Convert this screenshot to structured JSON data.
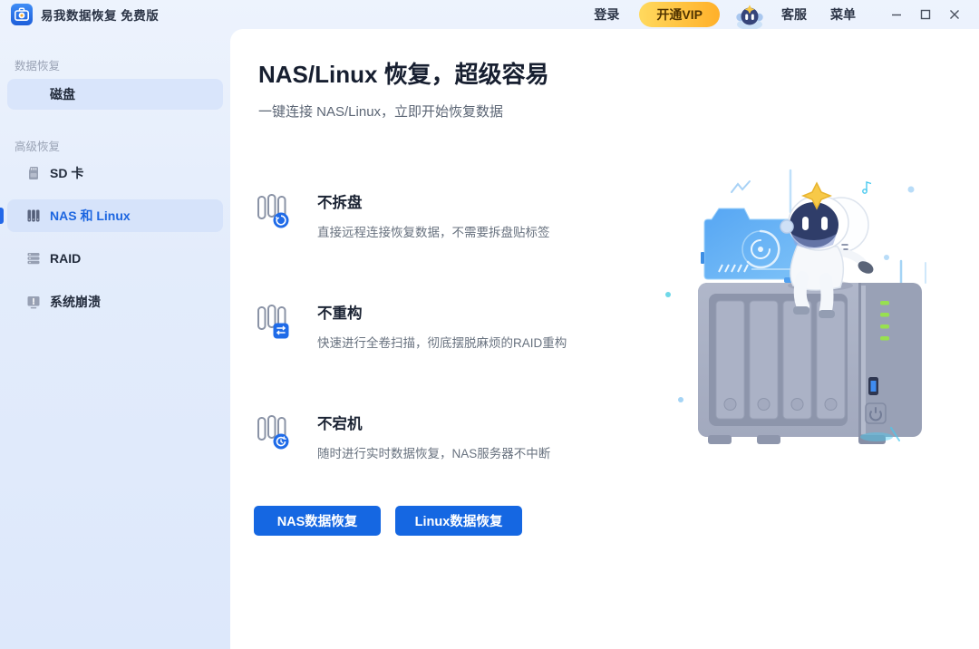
{
  "titlebar": {
    "app_title": "易我数据恢复 免费版",
    "app_icon": "medical-kit-plus-icon",
    "login_label": "登录",
    "vip_label": "开通VIP",
    "avatar_icon": "robot-mascot-avatar",
    "support_label": "客服",
    "menu_label": "菜单",
    "window_controls": [
      "minimize-icon",
      "maximize-icon",
      "close-icon"
    ]
  },
  "sidebar": {
    "sections": [
      {
        "label": "数据恢复",
        "items": [
          {
            "label": "磁盘",
            "icon": "none",
            "state": "highlighted"
          }
        ]
      },
      {
        "label": "高级恢复",
        "items": [
          {
            "label": "SD 卡",
            "icon": "sd-card-icon",
            "state": "normal"
          },
          {
            "label": "NAS 和 Linux",
            "icon": "nas-server-icon",
            "state": "selected"
          },
          {
            "label": "RAID",
            "icon": "raid-stack-icon",
            "state": "normal"
          },
          {
            "label": "系统崩溃",
            "icon": "system-crash-icon",
            "state": "normal"
          }
        ]
      }
    ]
  },
  "main": {
    "title": "NAS/Linux 恢复，超级容易",
    "subtitle": "一键连接 NAS/Linux，立即开始恢复数据",
    "features": [
      {
        "title": "不拆盘",
        "desc": "直接远程连接恢复数据，不需要拆盘贴标签",
        "icon": "nas-remote-connect-icon"
      },
      {
        "title": "不重构",
        "desc": "快速进行全卷扫描，彻底摆脱麻烦的RAID重构",
        "icon": "nas-full-scan-icon"
      },
      {
        "title": "不宕机",
        "desc": "随时进行实时数据恢复，NAS服务器不中断",
        "icon": "nas-uptime-icon"
      }
    ],
    "buttons": [
      {
        "label": "NAS数据恢复"
      },
      {
        "label": "Linux数据恢复"
      }
    ],
    "illustration": "robot-mascot-sitting-on-nas-tower-with-recovery-hologram"
  },
  "colors": {
    "accent_blue": "#1567e2",
    "selected_text_blue": "#1d66e0",
    "selected_item_bg": "#d6e3fa",
    "sidebar_bg": "#e3ecfb",
    "vip_gradient_start": "#ffd95e",
    "vip_gradient_end": "#ffb02a",
    "led_green": "#98e050",
    "hologram_blue": "#58a8f4"
  }
}
